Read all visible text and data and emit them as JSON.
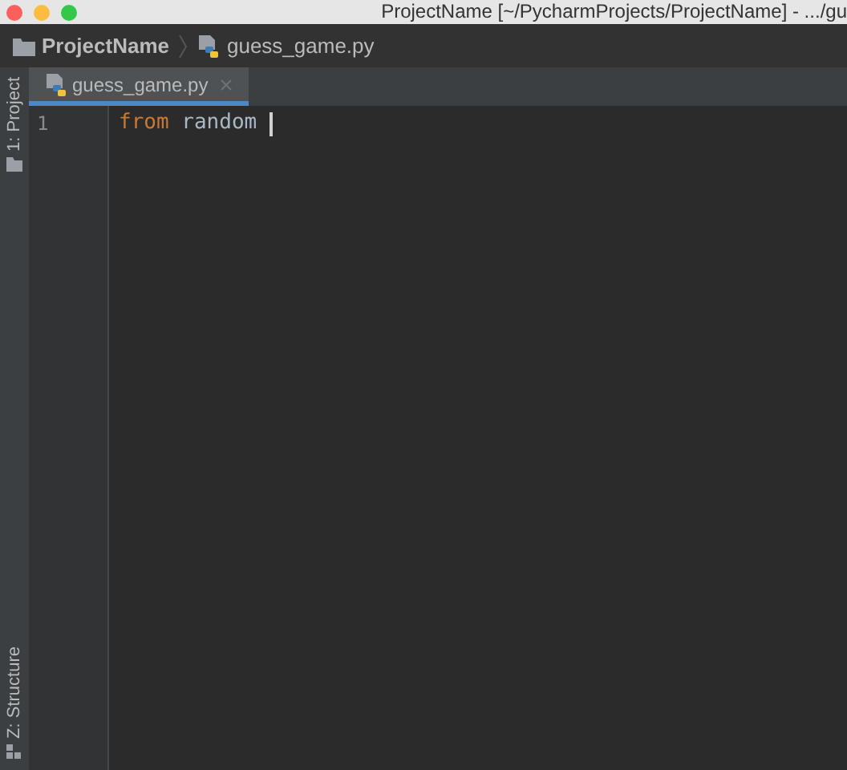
{
  "window": {
    "title": "ProjectName [~/PycharmProjects/ProjectName] - .../gu"
  },
  "navbar": {
    "breadcrumbs": [
      {
        "label": "ProjectName",
        "kind": "folder"
      },
      {
        "label": "guess_game.py",
        "kind": "python"
      }
    ]
  },
  "tool_strip": [
    {
      "label": "1: Project",
      "kind": "project"
    },
    {
      "label": "Z: Structure",
      "kind": "structure"
    }
  ],
  "tabs": [
    {
      "label": "guess_game.py",
      "selected": true
    }
  ],
  "editor": {
    "lines": [
      {
        "number": "1",
        "caret": true,
        "tokens": [
          {
            "text": "from",
            "kind": "keyword"
          },
          {
            "text": " random ",
            "kind": "plain"
          }
        ]
      }
    ]
  }
}
